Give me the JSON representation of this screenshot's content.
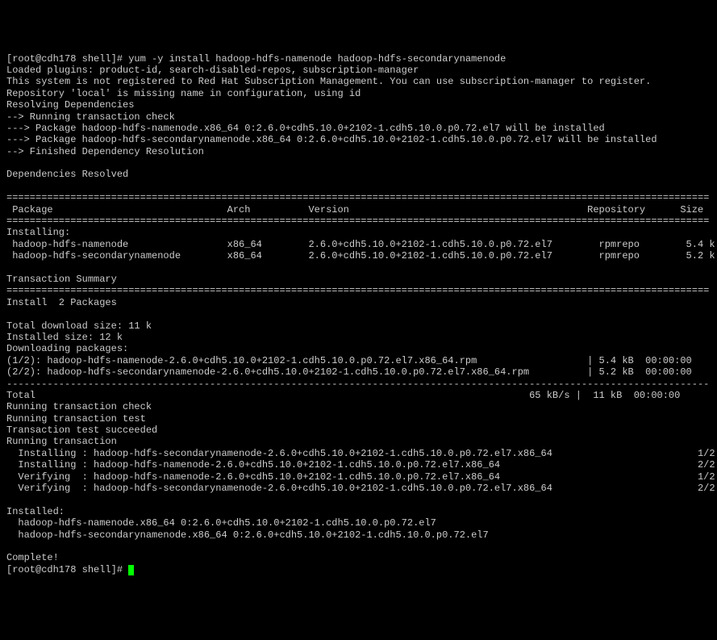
{
  "prompt1": "[root@cdh178 shell]# ",
  "command": "yum -y install hadoop-hdfs-namenode hadoop-hdfs-secondarynamenode",
  "line_plugins": "Loaded plugins: product-id, search-disabled-repos, subscription-manager",
  "line_notreg": "This system is not registered to Red Hat Subscription Management. You can use subscription-manager to register.",
  "line_repo": "Repository 'local' is missing name in configuration, using id",
  "line_resolving": "Resolving Dependencies",
  "line_running_check": "--> Running transaction check",
  "line_pkg1": "---> Package hadoop-hdfs-namenode.x86_64 0:2.6.0+cdh5.10.0+2102-1.cdh5.10.0.p0.72.el7 will be installed",
  "line_pkg2": "---> Package hadoop-hdfs-secondarynamenode.x86_64 0:2.6.0+cdh5.10.0+2102-1.cdh5.10.0.p0.72.el7 will be installed",
  "line_finished": "--> Finished Dependency Resolution",
  "line_deps_resolved": "Dependencies Resolved",
  "sep_eq": "=========================================================================================================================",
  "hdr": " Package                              Arch          Version                                         Repository      Size",
  "installing_hdr": "Installing:",
  "row1": " hadoop-hdfs-namenode                 x86_64        2.6.0+cdh5.10.0+2102-1.cdh5.10.0.p0.72.el7        rpmrepo        5.4 k",
  "row2": " hadoop-hdfs-secondarynamenode        x86_64        2.6.0+cdh5.10.0+2102-1.cdh5.10.0.p0.72.el7        rpmrepo        5.2 k",
  "txn_summary": "Transaction Summary",
  "install_count": "Install  2 Packages",
  "total_dl": "Total download size: 11 k",
  "installed_size": "Installed size: 12 k",
  "downloading": "Downloading packages:",
  "dl1": "(1/2): hadoop-hdfs-namenode-2.6.0+cdh5.10.0+2102-1.cdh5.10.0.p0.72.el7.x86_64.rpm                   | 5.4 kB  00:00:00",
  "dl2": "(2/2): hadoop-hdfs-secondarynamenode-2.6.0+cdh5.10.0+2102-1.cdh5.10.0.p0.72.el7.x86_64.rpm          | 5.2 kB  00:00:00",
  "sep_dash": "-------------------------------------------------------------------------------------------------------------------------",
  "total_line": "Total                                                                                     65 kB/s |  11 kB  00:00:00",
  "run_txn_check": "Running transaction check",
  "run_txn_test": "Running transaction test",
  "txn_test_ok": "Transaction test succeeded",
  "run_txn": "Running transaction",
  "inst1": "  Installing : hadoop-hdfs-secondarynamenode-2.6.0+cdh5.10.0+2102-1.cdh5.10.0.p0.72.el7.x86_64                         1/2",
  "inst2": "  Installing : hadoop-hdfs-namenode-2.6.0+cdh5.10.0+2102-1.cdh5.10.0.p0.72.el7.x86_64                                  2/2",
  "ver1": "  Verifying  : hadoop-hdfs-namenode-2.6.0+cdh5.10.0+2102-1.cdh5.10.0.p0.72.el7.x86_64                                  1/2",
  "ver2": "  Verifying  : hadoop-hdfs-secondarynamenode-2.6.0+cdh5.10.0+2102-1.cdh5.10.0.p0.72.el7.x86_64                         2/2",
  "installed_hdr": "Installed:",
  "installed1": "  hadoop-hdfs-namenode.x86_64 0:2.6.0+cdh5.10.0+2102-1.cdh5.10.0.p0.72.el7",
  "installed2": "  hadoop-hdfs-secondarynamenode.x86_64 0:2.6.0+cdh5.10.0+2102-1.cdh5.10.0.p0.72.el7",
  "complete": "Complete!",
  "prompt2": "[root@cdh178 shell]# "
}
